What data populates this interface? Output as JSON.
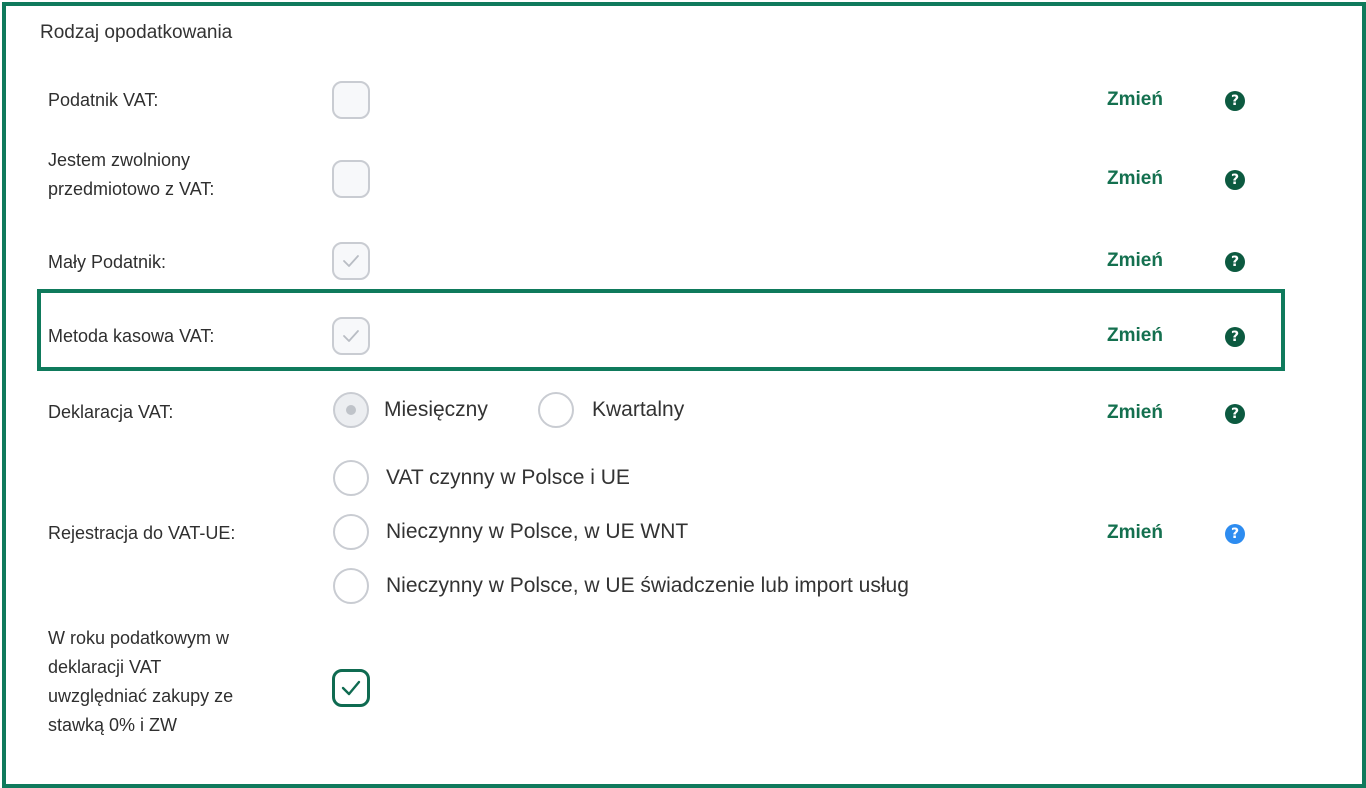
{
  "section": {
    "title": "Rodzaj opodatkowania"
  },
  "rows": {
    "podatnik_vat": {
      "label": "Podatnik VAT:",
      "change": "Zmień",
      "help": "?"
    },
    "zwolniony": {
      "label_line1": "Jestem zwolniony",
      "label_line2": "przedmiotowo z VAT:",
      "change": "Zmień",
      "help": "?"
    },
    "maly_podatnik": {
      "label": "Mały Podatnik:",
      "change": "Zmień",
      "help": "?"
    },
    "metoda_kasowa": {
      "label": "Metoda kasowa VAT:",
      "change": "Zmień",
      "help": "?"
    },
    "deklaracja": {
      "label": "Deklaracja VAT:",
      "options": [
        "Miesięczny",
        "Kwartalny"
      ],
      "selected": "Miesięczny",
      "change": "Zmień",
      "help": "?"
    },
    "rejestracja": {
      "label": "Rejestracja do VAT-UE:",
      "options": [
        "VAT czynny w Polsce i UE",
        "Nieczynny w Polsce, w UE WNT",
        "Nieczynny w Polsce, w UE świadczenie lub import usług"
      ],
      "change": "Zmień",
      "help": "?"
    },
    "zakupy": {
      "label_lines": [
        "W roku podatkowym w",
        "deklaracji VAT",
        "uwzględniać zakupy ze",
        "stawką 0% i ZW"
      ]
    }
  },
  "states": {
    "podatnik_vat": false,
    "zwolniony": false,
    "maly_podatnik": true,
    "metoda_kasowa": true,
    "zakupy": true
  },
  "colors": {
    "frame": "#0f7a5c",
    "link": "#14704f",
    "help_dark": "#0c5a40",
    "help_blue": "#2d8cf0"
  }
}
